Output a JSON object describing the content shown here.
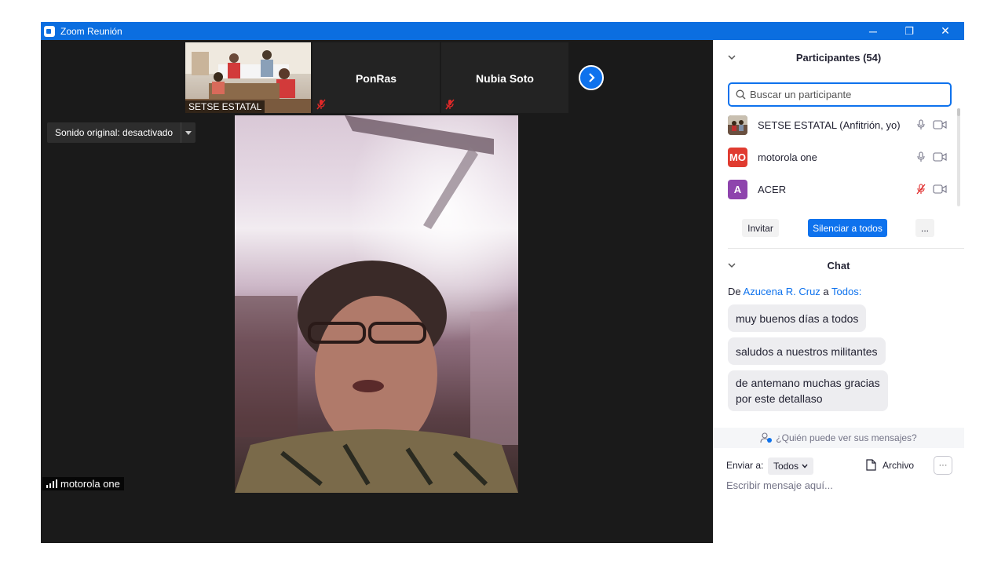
{
  "window": {
    "title": "Zoom Reunión",
    "minimize": "─",
    "restore": "❐",
    "close": "✕"
  },
  "video_strip": {
    "tiles": [
      {
        "name": "SETSE ESTATAL"
      },
      {
        "name": "PonRas"
      },
      {
        "name": "Nubia Soto"
      }
    ]
  },
  "original_sound": {
    "label": "Sonido original: desactivado"
  },
  "active_speaker": {
    "name": "motorola one"
  },
  "participants": {
    "title": "Participantes (54)",
    "search_placeholder": "Buscar un participante",
    "list": [
      {
        "avatar": "",
        "name": "SETSE ESTATAL (Anfitrión, yo)",
        "avatar_color": "#5a5a4a",
        "mic_muted": false
      },
      {
        "avatar": "MO",
        "name": "motorola one",
        "avatar_color": "#e03b30",
        "mic_muted": false
      },
      {
        "avatar": "A",
        "name": "ACER",
        "avatar_color": "#8e44ad",
        "mic_muted": true
      }
    ],
    "invite_label": "Invitar",
    "mute_all_label": "Silenciar a todos",
    "more_label": "..."
  },
  "chat": {
    "title": "Chat",
    "from_prefix": "De",
    "sender": "Azucena R. Cruz",
    "to_word": "a",
    "recipient": "Todos:",
    "messages": [
      {
        "line1": "muy buenos días a todos",
        "line2": ""
      },
      {
        "line1": "saludos a nuestros militantes",
        "line2": ""
      },
      {
        "line1": "de antemano muchas gracias",
        "line2": "por este detallaso"
      }
    ],
    "who_can_see": "¿Quién puede ver sus mensajes?",
    "send_to_label": "Enviar a:",
    "send_to_value": "Todos",
    "file_label": "Archivo",
    "more_label": "···",
    "input_placeholder": "Escribir mensaje aquí..."
  },
  "colors": {
    "accent": "#0e72ed",
    "titlebar": "#0b6ee0",
    "video_bg": "#1a1a1a",
    "muted_red": "#e02828"
  }
}
